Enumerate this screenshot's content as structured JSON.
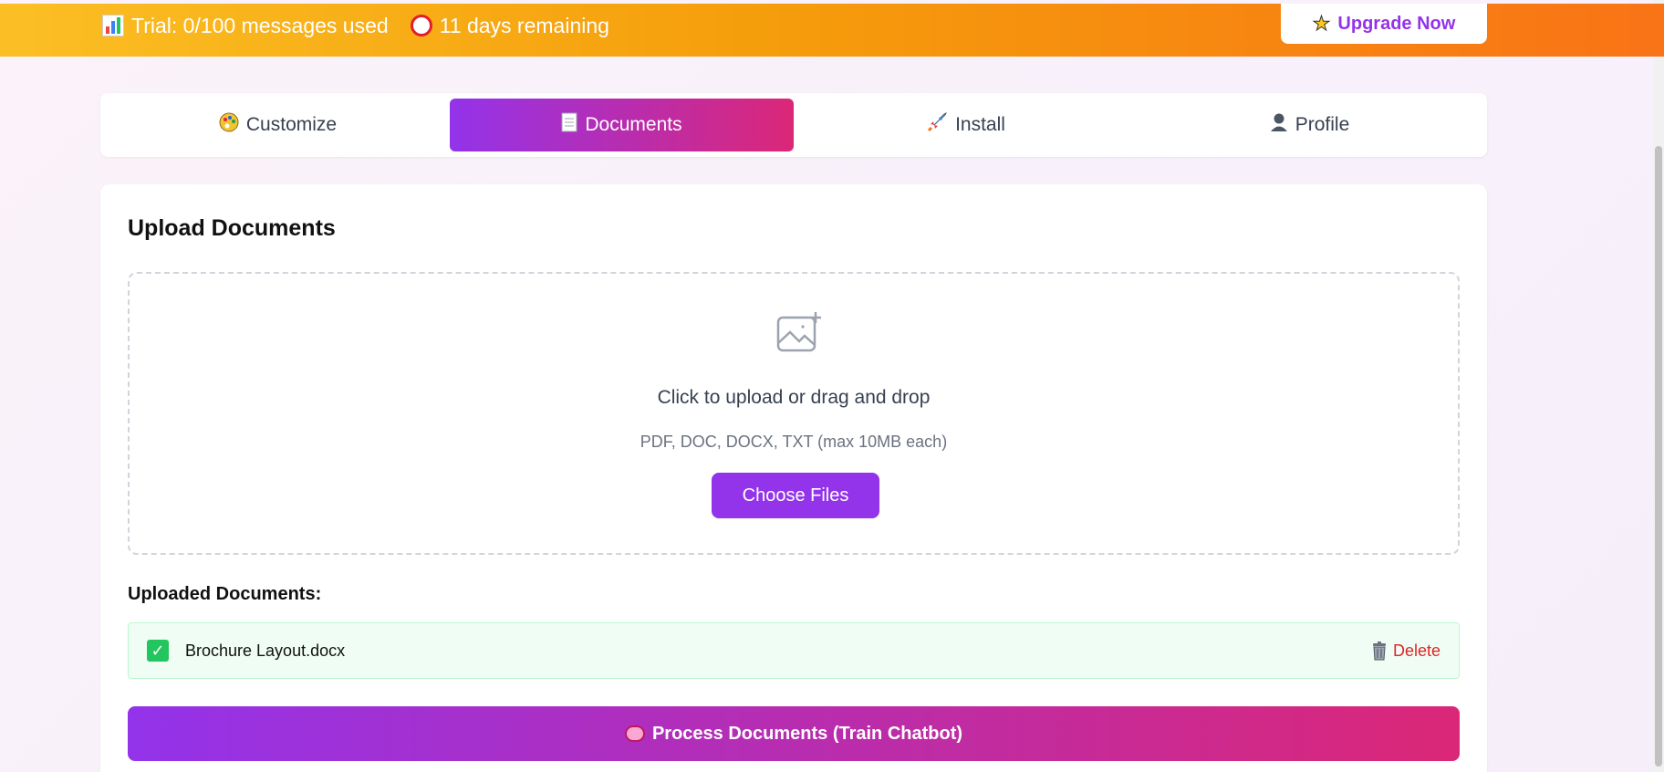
{
  "banner": {
    "trial_text": "Trial: 0/100 messages used",
    "days_text": "11 days remaining",
    "upgrade_label": "Upgrade Now",
    "colors": {
      "gradient_start": "#fbbf24",
      "gradient_end": "#f97316"
    }
  },
  "tabs": [
    {
      "label": "Customize",
      "icon": "palette-icon",
      "active": false
    },
    {
      "label": "Documents",
      "icon": "page-icon",
      "active": true
    },
    {
      "label": "Install",
      "icon": "rocket-icon",
      "active": false
    },
    {
      "label": "Profile",
      "icon": "user-icon",
      "active": false
    }
  ],
  "upload": {
    "title": "Upload Documents",
    "drop_main": "Click to upload or drag and drop",
    "drop_sub": "PDF, DOC, DOCX, TXT (max 10MB each)",
    "choose_label": "Choose Files"
  },
  "uploaded": {
    "title": "Uploaded Documents:",
    "files": [
      {
        "name": "Brochure Layout.docx",
        "status": "uploaded",
        "delete_label": "Delete"
      }
    ]
  },
  "process_label": "Process Documents (Train Chatbot)",
  "colors": {
    "accent_purple": "#9333ea",
    "accent_pink": "#db2777",
    "delete_red": "#dc2626",
    "success_green": "#22c55e"
  }
}
